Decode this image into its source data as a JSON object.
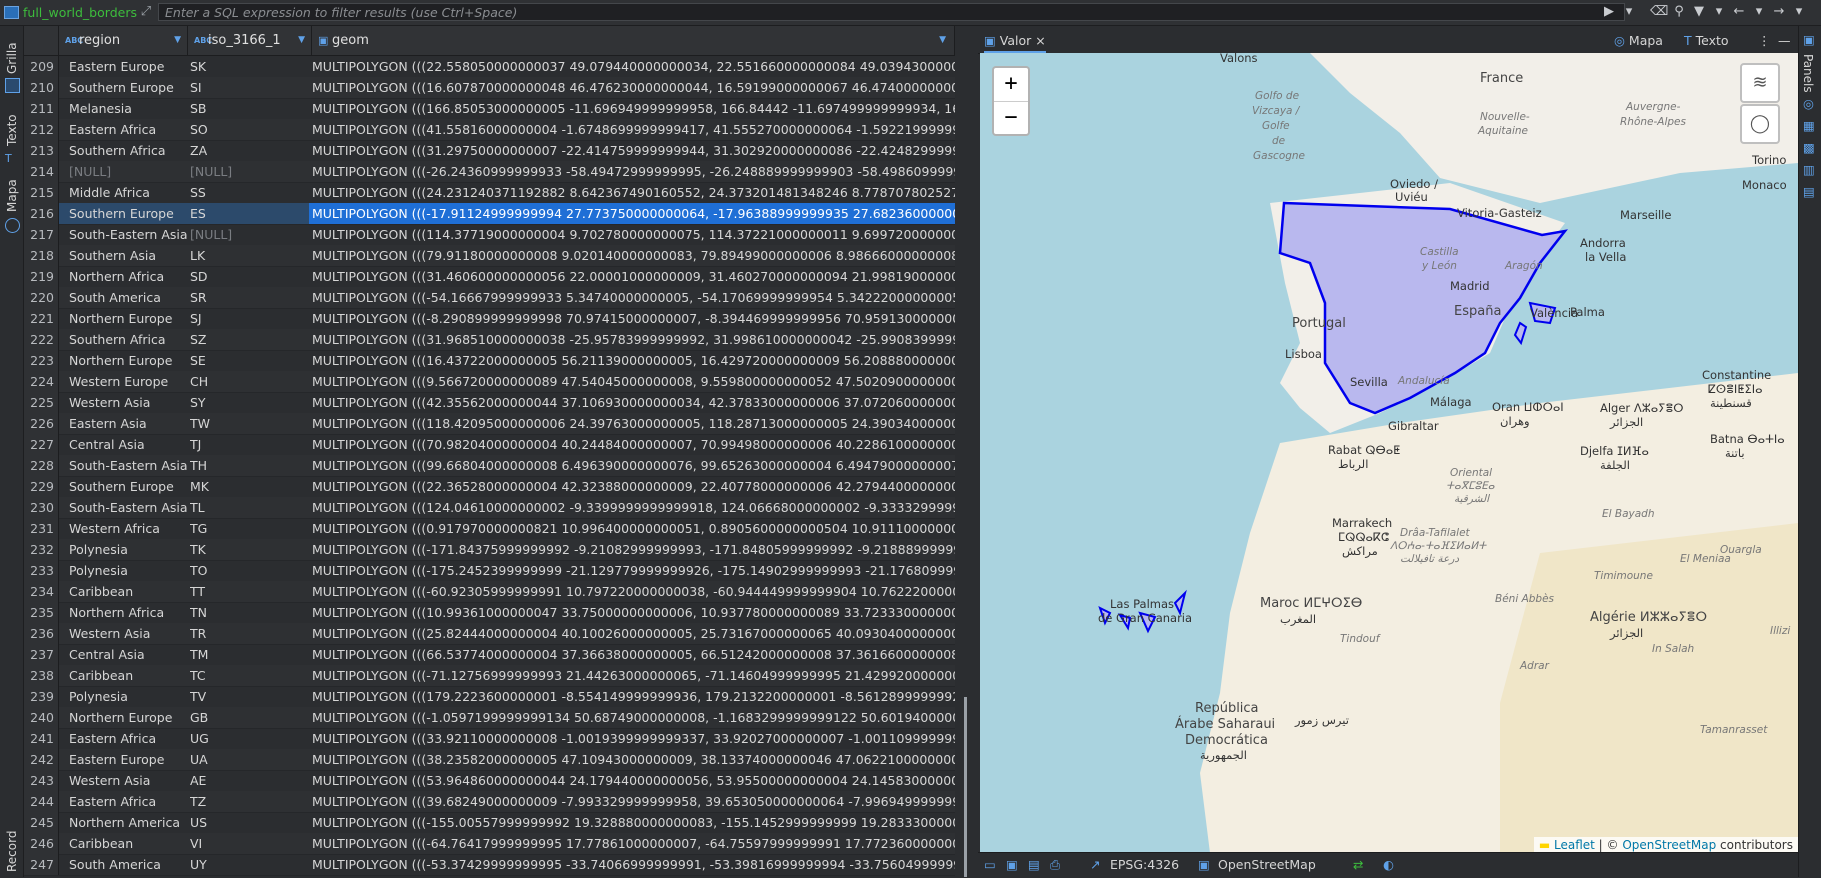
{
  "toolbar": {
    "table_name": "full_world_borders",
    "filter_placeholder": "Enter a SQL expression to filter results (use Ctrl+Space)"
  },
  "left_tabs": {
    "grid": "Grilla",
    "text": "Texto",
    "map": "Mapa",
    "record": "Record"
  },
  "columns": [
    "region",
    "iso_3166_1",
    "geom"
  ],
  "rows": [
    {
      "n": "209",
      "region": "Eastern Europe",
      "iso": "SK",
      "geom": "MULTIPOLYGON (((22.558050000000037 49.079440000000034, 22.551660000000084 49.03943000000004, 22.53"
    },
    {
      "n": "210",
      "region": "Southern Europe",
      "iso": "SI",
      "geom": "MULTIPOLYGON (((16.607870000000048 46.476230000000044, 16.59199000000067 46.474000000000046, 16.56"
    },
    {
      "n": "211",
      "region": "Melanesia",
      "iso": "SB",
      "geom": "MULTIPOLYGON (((166.85053000000005 -11.696949999999958, 166.84442 -11.697499999999934, 166.833200"
    },
    {
      "n": "212",
      "region": "Eastern Africa",
      "iso": "SO",
      "geom": "MULTIPOLYGON (((41.55816000000004 -1.6748699999999417, 41.555270000000064 -1.5922199999999407, 41.38"
    },
    {
      "n": "213",
      "region": "Southern Africa",
      "iso": "ZA",
      "geom": "MULTIPOLYGON (((31.29750000000007 -22.414759999999944, 31.302920000000086 -22.42482999999993, 31.51"
    },
    {
      "n": "214",
      "region": "[NULL]",
      "iso": "[NULL]",
      "geom": "MULTIPOLYGON (((-26.24360999999933 -58.49472999999995, -26.248889999999903 -58.49860999999993, -26"
    },
    {
      "n": "215",
      "region": "Middle Africa",
      "iso": "SS",
      "geom": "MULTIPOLYGON (((24.231240371192882 8.642367490160552, 24.373201481348246 8.778707802527322, 24.5302"
    },
    {
      "n": "216",
      "region": "Southern Europe",
      "iso": "ES",
      "geom": "MULTIPOLYGON (((-17.91124999999994 27.773750000000064, -17.96388999999935 27.682360000000074, -17.9"
    },
    {
      "n": "217",
      "region": "South-Eastern Asia",
      "iso": "[NULL]",
      "geom": "MULTIPOLYGON (((114.37719000000004 9.702780000000075, 114.37221000000011 9.69972000000007, 114.36943("
    },
    {
      "n": "218",
      "region": "Southern Asia",
      "iso": "LK",
      "geom": "MULTIPOLYGON (((79.91180000000008 9.020140000000083, 79.89499000000006 8.986660000000086, 79.85054("
    },
    {
      "n": "219",
      "region": "Northern Africa",
      "iso": "SD",
      "geom": "MULTIPOLYGON (((31.460600000000056 22.00001000000009, 31.460270000000094 21.998190000000136, 33.2510"
    },
    {
      "n": "220",
      "region": "South America",
      "iso": "SR",
      "geom": "MULTIPOLYGON (((-54.16667999999933 5.34740000000005, -54.17069999999954 5.342220000000054, -54.193"
    },
    {
      "n": "221",
      "region": "Northern Europe",
      "iso": "SJ",
      "geom": "MULTIPOLYGON (((-8.290899999999998 70.97415000000007, -8.394469999999956 70.95913000000007, -8.4091"
    },
    {
      "n": "222",
      "region": "Southern Africa",
      "iso": "SZ",
      "geom": "MULTIPOLYGON (((31.968510000000038 -25.95783999999992, 31.998610000000042 -25.99083999999935, 32.0"
    },
    {
      "n": "223",
      "region": "Northern Europe",
      "iso": "SE",
      "geom": "MULTIPOLYGON (((16.43722000000005 56.21139000000005, 16.429720000000009 56.20888000000008, 16.418470"
    },
    {
      "n": "224",
      "region": "Western Europe",
      "iso": "CH",
      "geom": "MULTIPOLYGON (((9.566720000000089 47.54045000000008, 9.559800000000052 47.50209000000007, 9.59660("
    },
    {
      "n": "225",
      "region": "Western Asia",
      "iso": "SY",
      "geom": "MULTIPOLYGON (((42.35562000000044 37.106930000000034, 42.37833000000006 37.07206000000008, 42.374"
    },
    {
      "n": "226",
      "region": "Eastern Asia",
      "iso": "TW",
      "geom": "MULTIPOLYGON (((118.42095000000006 24.39763000000005, 118.28713000000005 24.390340000000037, 118.278"
    },
    {
      "n": "227",
      "region": "Central Asia",
      "iso": "TJ",
      "geom": "MULTIPOLYGON (((70.98204000000004 40.24484000000007, 70.99498000000006 40.22861000000006, 70.98567"
    },
    {
      "n": "228",
      "region": "South-Eastern Asia",
      "iso": "TH",
      "geom": "MULTIPOLYGON (((99.66804000000008 6.496390000000076, 99.65263000000004 6.494790000000077, 99.59665("
    },
    {
      "n": "229",
      "region": "Southern Europe",
      "iso": "MK",
      "geom": "MULTIPOLYGON (((22.36528000000004 42.32388000000009, 22.40778000000006 42.27944000000008, 22.51944"
    },
    {
      "n": "230",
      "region": "South-Eastern Asia",
      "iso": "TL",
      "geom": "MULTIPOLYGON (((124.04610000000002 -9.3399999999999918, 124.06668000000002 -9.33332999999933, 124.13"
    },
    {
      "n": "231",
      "region": "Western Africa",
      "iso": "TG",
      "geom": "MULTIPOLYGON (((0.917970000000821 10.996400000000051, 0.8905600000000504 10.911100000000065, 0.8936"
    },
    {
      "n": "232",
      "region": "Polynesia",
      "iso": "TK",
      "geom": "MULTIPOLYGON (((-171.84375999999992 -9.21082999999993, -171.84805999999992 -9.21888999999993, -171.85"
    },
    {
      "n": "233",
      "region": "Polynesia",
      "iso": "TO",
      "geom": "MULTIPOLYGON (((-175.2452399999999 -21.129779999999926, -175.14902999999993 -21.176809999999932, -175"
    },
    {
      "n": "234",
      "region": "Caribbean",
      "iso": "TT",
      "geom": "MULTIPOLYGON (((-60.92305999999991 10.797220000000038, -60.944449999999904 10.76222000000007, -60.9"
    },
    {
      "n": "235",
      "region": "Northern Africa",
      "iso": "TN",
      "geom": "MULTIPOLYGON (((10.99361000000047 33.75000000000006, 10.937780000000089 33.72333000000009, 10.8827"
    },
    {
      "n": "236",
      "region": "Western Asia",
      "iso": "TR",
      "geom": "MULTIPOLYGON (((25.82444000000004 40.10026000000005, 25.73167000000065 40.09304000000009, 25.6658"
    },
    {
      "n": "237",
      "region": "Central Asia",
      "iso": "TM",
      "geom": "MULTIPOLYGON (((66.53774000000004 37.36638000000005, 66.51242000000008 37.36166000000086, 66.4898"
    },
    {
      "n": "238",
      "region": "Caribbean",
      "iso": "TC",
      "geom": "MULTIPOLYGON (((-71.12756999999993 21.44263000000065, -71.14604999999995 21.42992000000004, -71.1506"
    },
    {
      "n": "239",
      "region": "Polynesia",
      "iso": "TV",
      "geom": "MULTIPOLYGON (((179.2223600000001 -8.554149999999936, 179.2132200000001 -8.56128999999929, 179.2024"
    },
    {
      "n": "240",
      "region": "Northern Europe",
      "iso": "GB",
      "geom": "MULTIPOLYGON (((-1.0597199999999134 50.68749000000008, -1.1683299999999122 50.60194000000007, -1.1913"
    },
    {
      "n": "241",
      "region": "Eastern Africa",
      "iso": "UG",
      "geom": "MULTIPOLYGON (((33.92110000000008 -1.0019399999999337, 33.92027000000007 -1.001109999999926, 33.4608"
    },
    {
      "n": "242",
      "region": "Eastern Europe",
      "iso": "UA",
      "geom": "MULTIPOLYGON (((38.23582000000005 47.10943000000009, 38.13374000000046 47.06221000000005, 38.0713"
    },
    {
      "n": "243",
      "region": "Western Asia",
      "iso": "AE",
      "geom": "MULTIPOLYGON (((53.964860000000044 24.179440000000056, 53.95500000000004 24.145830000000046, 53.94"
    },
    {
      "n": "244",
      "region": "Eastern Africa",
      "iso": "TZ",
      "geom": "MULTIPOLYGON (((39.68249000000009 -7.993329999999958, 39.653050000000064 -7.996949999999913, 39.64"
    },
    {
      "n": "245",
      "region": "Northern America",
      "iso": "US",
      "geom": "MULTIPOLYGON (((-155.00557999999992 19.328880000000083, -155.1452999999999 19.283330000000092, -155."
    },
    {
      "n": "246",
      "region": "Caribbean",
      "iso": "VI",
      "geom": "MULTIPOLYGON (((-64.76417999999995 17.77861000000007, -64.75597999999991 17.77236000000005, -64.7386"
    },
    {
      "n": "247",
      "region": "South America",
      "iso": "UY",
      "geom": "MULTIPOLYGON (((-53.37429999999995 -33.74066999999991, -53.39816999999994 -33.75604999999904, -53.4"
    }
  ],
  "map": {
    "tab": "Valor",
    "mapa_btn": "Mapa",
    "texto_btn": "Texto",
    "zoom_in": "+",
    "zoom_out": "−",
    "labels": {
      "valons": "Valons",
      "france": "France",
      "golfe": "Golfo de",
      "vizcaya": "Vizcaya /",
      "golfe2": "Golfe",
      "de": "de",
      "gascogne": "Gascogne",
      "nouvelle": "Nouvelle-",
      "aquitaine": "Aquitaine",
      "auvergne": "Auvergne-",
      "rhone": "Rhône-Alpes",
      "oviedo": "Oviedo /",
      "uviedu": "Uviéu",
      "vitoria": "Vitoria-Gasteiz",
      "marseille": "Marseille",
      "monaco": "Monaco",
      "torino": "Torino",
      "castilla": "Castilla",
      "yleon": "y León",
      "aragon": "Aragón",
      "andorra": "Andorra",
      "lavella": "la Vella",
      "madrid": "Madrid",
      "espana": "España",
      "valencia": "València",
      "portugal": "Portugal",
      "lisboa": "Lisboa",
      "palma": "Palma",
      "sevilla": "Sevilla",
      "andalucia": "Andalucía",
      "malaga": "Málaga",
      "gibraltar": "Gibraltar",
      "oran": "Oran ⵡⵀⵔⴰⵏ",
      "oran_ar": "وهران",
      "alger": "Alger ⴷⵣⴰⵢⴻⵔ",
      "alger_ar": "الجزائر",
      "constantine": "Constantine",
      "constantine2": "ⵇⵙⴻⵏⵟⵉⵏⴰ",
      "constantine_ar": "قسنطينة",
      "rabat": "Rabat ⵕⴱⴰⵟ",
      "rabat_ar": "الرباط",
      "djelfa": "Djelfa ⵊⵍⴼⴰ",
      "djelfa_ar": "الجلفة",
      "batna": "Batna ⴱⴰⵜⵏⴰ",
      "batna_ar": "باتنة",
      "oriental": "Oriental",
      "oriental2": "ⵜⴰⴳⵎⵓⴹⴰ",
      "oriental_ar": "الشرقية",
      "marrakech": "Marrakech",
      "marrakech2": "ⵎⵕⵕⴰⴽⵛ",
      "marrakech_ar": "مراكش",
      "draa": "Drâa-Tafilalet",
      "draa2": "ⴷⵔⵄⴰ-ⵜⴰⴼⵉⵍⴰⵍⵜ",
      "draa_ar": "درعة تافيلالت",
      "elbayadh": "El Bayadh",
      "ouargla": "Ouargla",
      "timimoune": "Timimoune",
      "elmeniaa": "El Meniaa",
      "lasp": "Las Palmas",
      "grancanaria": "de Gran Canaria",
      "maroc": "Maroc ⵍⵎⵖⵔⵉⴱ",
      "maroc_ar": "المغرب",
      "beniabbes": "Béni Abbès",
      "algerie": "Algérie ⵍⵣⵣⴰⵢⴻⵔ",
      "algerie_ar": "الجزائر",
      "tindouf": "Tindouf",
      "illizi": "Illizi",
      "adrar": "Adrar",
      "insalah": "In Salah",
      "republica": "República",
      "arabe": "Árabe Saharaui",
      "democratica": "Democrática",
      "democratica_ar": "الجمهورية",
      "tiris": "تيرس زمور",
      "tamanrasset": "Tamanrasset"
    },
    "attribution": {
      "leaflet": "Leaflet",
      "sep": " | © ",
      "osm": "OpenStreetMap",
      "contrib": " contributors"
    },
    "status": {
      "epsg": "EPSG:4326",
      "tiles": "OpenStreetMap"
    },
    "right_tab": "Panels"
  }
}
